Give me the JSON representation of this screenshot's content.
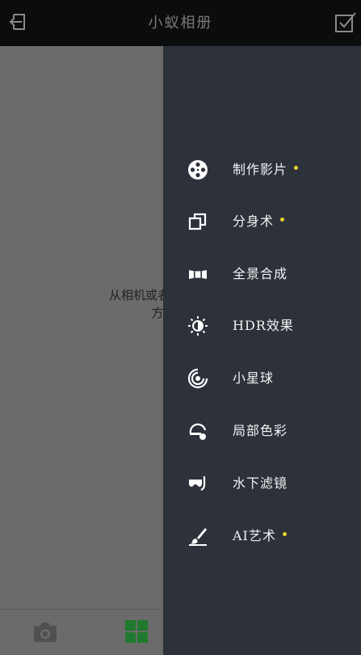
{
  "header": {
    "title": "小蚁相册"
  },
  "content": {
    "empty_line1": "从相机或者手机导入的",
    "empty_line2": "方便您"
  },
  "colors": {
    "accent_dot": "#e6d42b",
    "grid_tab_active": "#1f7a2e",
    "drawer_bg": "#2c313a"
  },
  "drawer": {
    "items": [
      {
        "label": "制作影片",
        "icon": "film-reel-icon",
        "new": true
      },
      {
        "label": "分身术",
        "icon": "clone-icon",
        "new": true
      },
      {
        "label": "全景合成",
        "icon": "panorama-icon",
        "new": false
      },
      {
        "label": "HDR效果",
        "icon": "hdr-icon",
        "new": false
      },
      {
        "label": "小星球",
        "icon": "tiny-planet-icon",
        "new": false
      },
      {
        "label": "局部色彩",
        "icon": "color-splash-icon",
        "new": false
      },
      {
        "label": "水下滤镜",
        "icon": "diving-mask-icon",
        "new": false
      },
      {
        "label": "AI艺术",
        "icon": "brush-icon",
        "new": true
      }
    ]
  }
}
